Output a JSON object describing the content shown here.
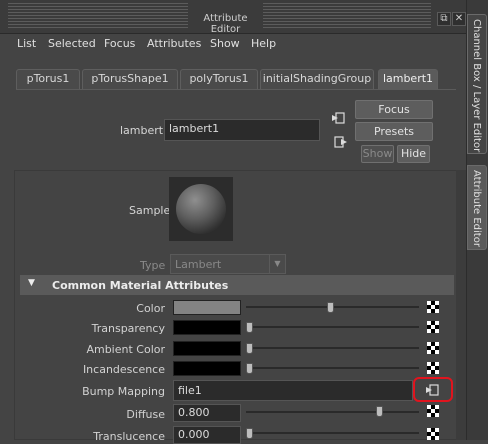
{
  "window": {
    "title": "Attribute Editor"
  },
  "menu": [
    "List",
    "Selected",
    "Focus",
    "Attributes",
    "Show",
    "Help"
  ],
  "tabs": [
    "pTorus1",
    "pTorusShape1",
    "polyTorus1",
    "initialShadingGroup",
    "lambert1"
  ],
  "active_tab": "lambert1",
  "node": {
    "label": "lambert:",
    "value": "lambert1"
  },
  "buttons": {
    "focus": "Focus",
    "presets": "Presets",
    "show": "Show",
    "hide": "Hide"
  },
  "sample": {
    "label": "Sample"
  },
  "type_field": {
    "label": "Type",
    "value": "Lambert"
  },
  "section": {
    "title": "Common Material Attributes",
    "collapse_icon": "triangle-down-icon"
  },
  "attributes": {
    "color": {
      "label": "Color",
      "swatch": "#838383",
      "slider": 0.5
    },
    "transparency": {
      "label": "Transparency",
      "swatch": "#000000",
      "slider": 0.0
    },
    "ambient": {
      "label": "Ambient Color",
      "swatch": "#000000",
      "slider": 0.0
    },
    "incandescence": {
      "label": "Incandescence",
      "swatch": "#000000",
      "slider": 0.0
    },
    "bump": {
      "label": "Bump Mapping",
      "value": "file1"
    },
    "diffuse": {
      "label": "Diffuse",
      "value": "0.800",
      "slider": 0.8
    },
    "translucence": {
      "label": "Translucence",
      "value": "0.000",
      "slider": 0.0
    }
  },
  "side_tabs": {
    "channel_box": "Channel Box / Layer Editor",
    "attribute_editor": "Attribute Editor"
  },
  "colors": {
    "highlight": "#e0141e"
  }
}
